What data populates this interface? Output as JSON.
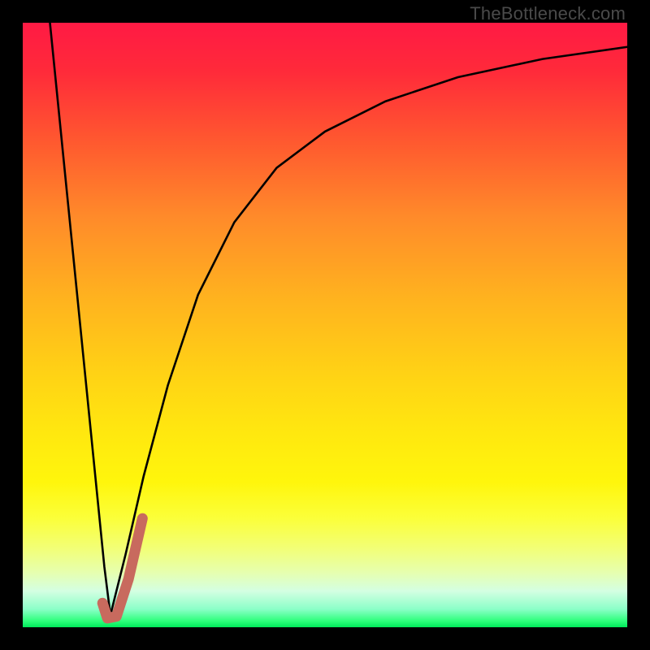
{
  "watermark": "TheBottleneck.com",
  "colors": {
    "frame_bg": "#000000",
    "curve_stroke": "#000000",
    "marker_stroke": "#c86a5e",
    "gradient_top": "#ff1a44",
    "gradient_bottom": "#00e85a"
  },
  "chart_data": {
    "type": "line",
    "title": "",
    "xlabel": "",
    "ylabel": "",
    "xlim": [
      0,
      100
    ],
    "ylim": [
      0,
      100
    ],
    "note": "Axes are unlabeled; values are normalized percentages (0=left/bottom, 100=right/top). Two black curves meet near the bottom; a short salmon J-shaped marker sits at the trough.",
    "series": [
      {
        "name": "left_descending_line",
        "x": [
          4.5,
          6.0,
          7.5,
          9.0,
          10.5,
          12.0,
          13.5,
          14.5
        ],
        "y": [
          100,
          85,
          70,
          55,
          40,
          25,
          10,
          2
        ]
      },
      {
        "name": "right_rising_curve",
        "x": [
          14.5,
          17,
          20,
          24,
          29,
          35,
          42,
          50,
          60,
          72,
          86,
          100
        ],
        "y": [
          2,
          12,
          25,
          40,
          55,
          67,
          76,
          82,
          87,
          91,
          94,
          96
        ]
      },
      {
        "name": "j_marker",
        "x": [
          13.2,
          14.0,
          15.5,
          17.5,
          19.8
        ],
        "y": [
          4.0,
          1.5,
          1.8,
          8.0,
          18.0
        ]
      }
    ]
  }
}
